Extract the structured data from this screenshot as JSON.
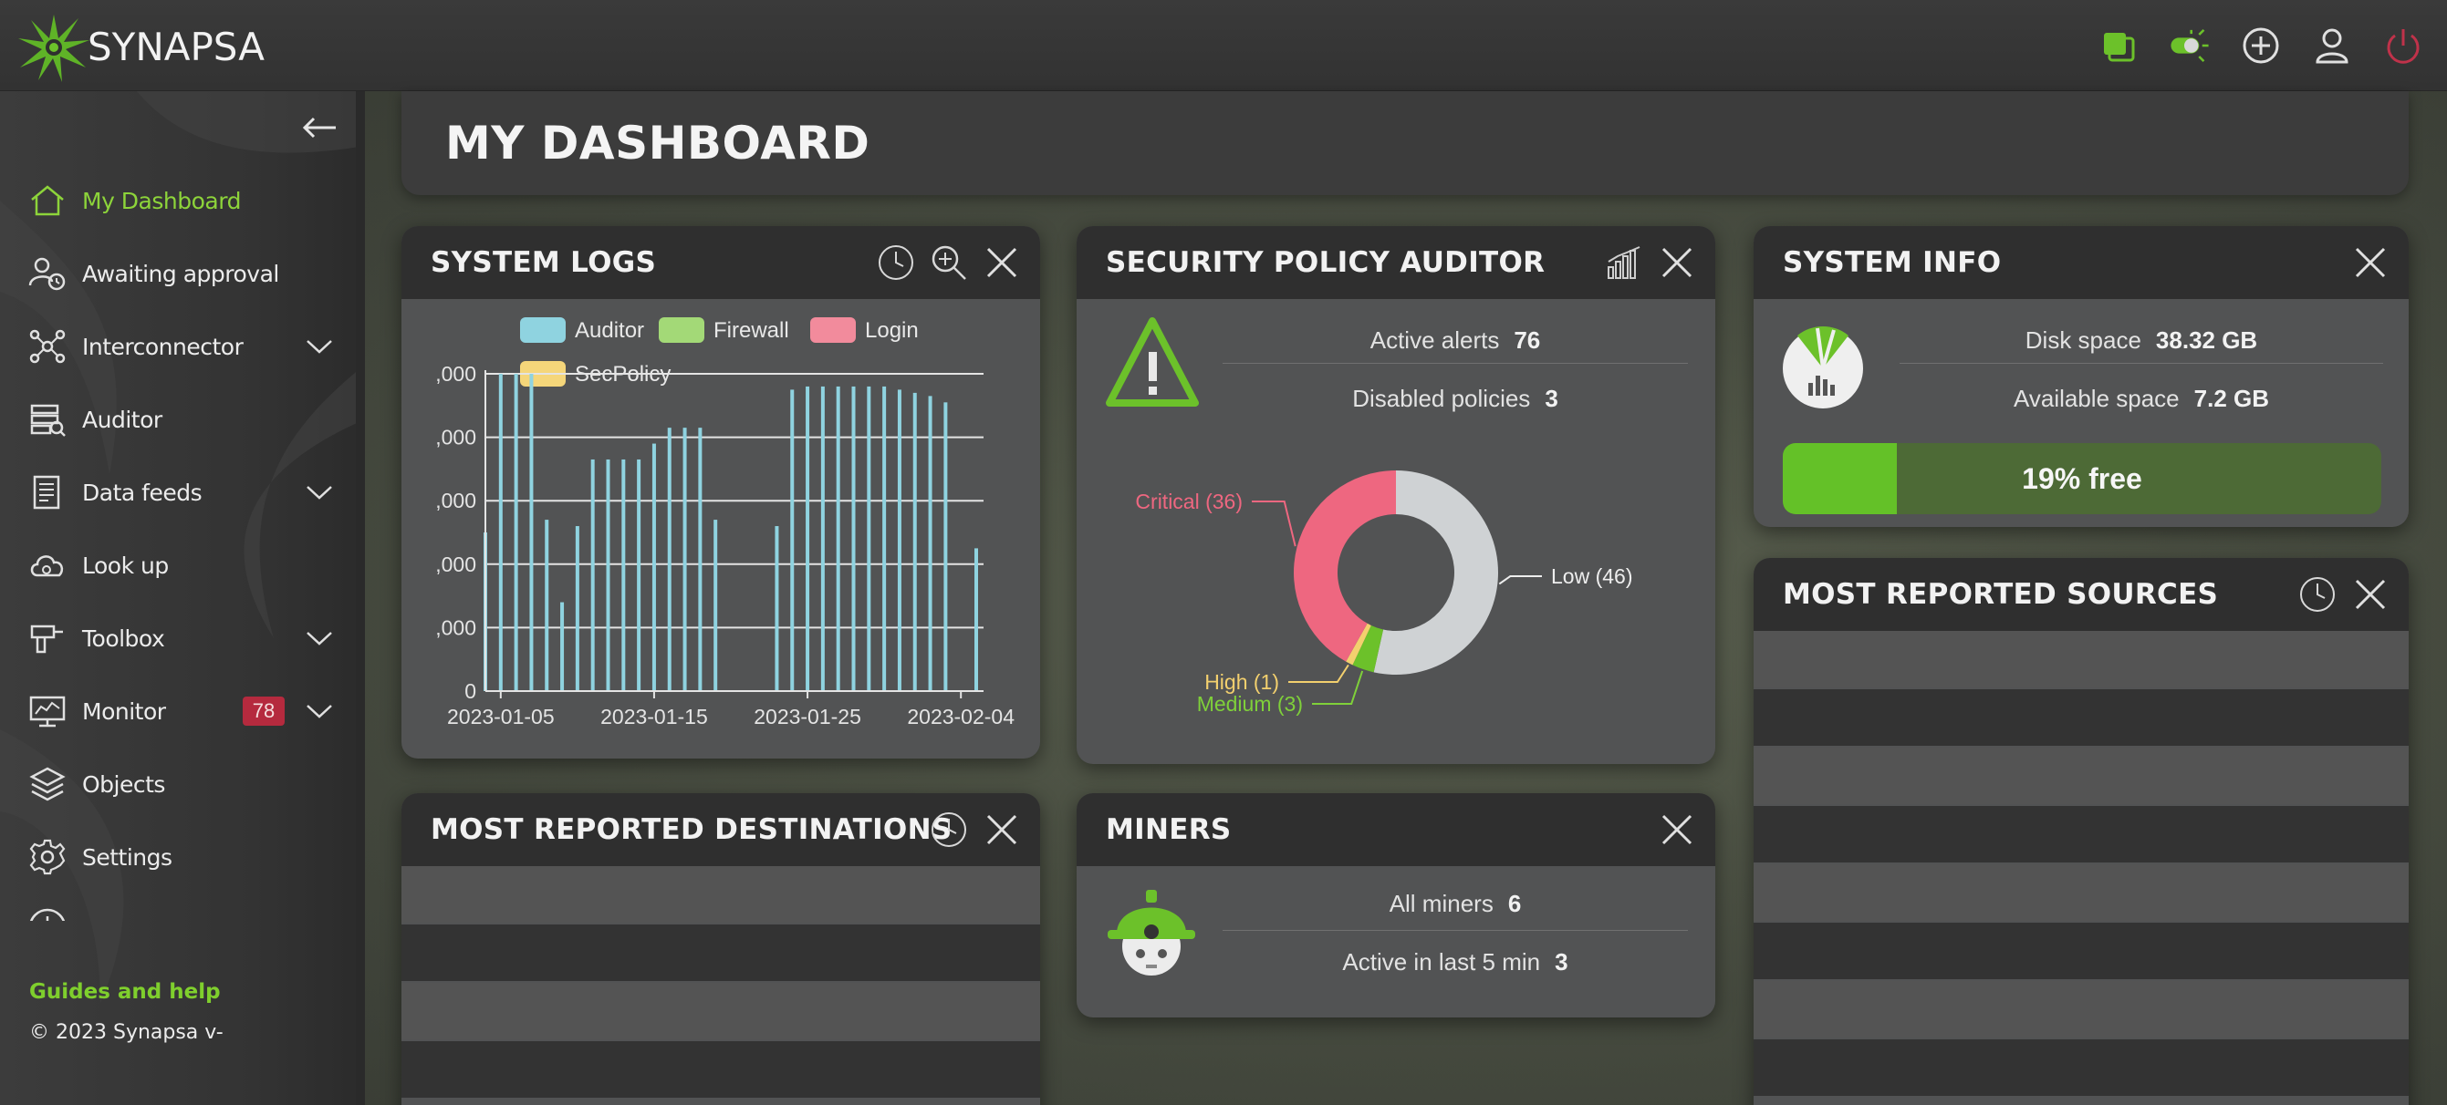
{
  "app": {
    "name": "SYNAPSA",
    "brand_color": "#6cc12a",
    "top_icons": [
      "window-icon",
      "theme-toggle-icon",
      "add-icon",
      "user-icon",
      "power-icon"
    ]
  },
  "sidebar": {
    "items": [
      {
        "label": "My Dashboard",
        "icon": "home-icon",
        "active": true
      },
      {
        "label": "Awaiting approval",
        "icon": "user-clock-icon"
      },
      {
        "label": "Interconnector",
        "icon": "network-icon",
        "expandable": true
      },
      {
        "label": "Auditor",
        "icon": "auditor-icon"
      },
      {
        "label": "Data feeds",
        "icon": "document-icon",
        "expandable": true
      },
      {
        "label": "Look up",
        "icon": "cloud-search-icon"
      },
      {
        "label": "Toolbox",
        "icon": "drill-icon",
        "expandable": true
      },
      {
        "label": "Monitor",
        "icon": "monitor-icon",
        "expandable": true,
        "badge": "78"
      },
      {
        "label": "Objects",
        "icon": "layers-icon"
      },
      {
        "label": "Settings",
        "icon": "gear-icon"
      }
    ],
    "guides_label": "Guides and help",
    "copyright": "© 2023 Synapsa v-"
  },
  "page": {
    "title": "MY DASHBOARD"
  },
  "system_logs": {
    "title": "SYSTEM LOGS",
    "legend": [
      {
        "name": "Auditor",
        "color": "#8fd3e0"
      },
      {
        "name": "Firewall",
        "color": "#a3d977"
      },
      {
        "name": "Login",
        "color": "#f28b9c"
      },
      {
        "name": "SecPolicy",
        "color": "#f5d67a"
      }
    ]
  },
  "chart_data": {
    "type": "bar",
    "series": [
      {
        "name": "Auditor",
        "color": "#8fd3e0",
        "points": [
          [
            "2023-01-04",
            2500
          ],
          [
            "2023-01-05",
            5000
          ],
          [
            "2023-01-06",
            5000
          ],
          [
            "2023-01-07",
            5000
          ],
          [
            "2023-01-08",
            2700
          ],
          [
            "2023-01-09",
            1400
          ],
          [
            "2023-01-10",
            2600
          ],
          [
            "2023-01-11",
            3650
          ],
          [
            "2023-01-12",
            3650
          ],
          [
            "2023-01-13",
            3650
          ],
          [
            "2023-01-14",
            3650
          ],
          [
            "2023-01-15",
            3900
          ],
          [
            "2023-01-16",
            4150
          ],
          [
            "2023-01-17",
            4150
          ],
          [
            "2023-01-18",
            4150
          ],
          [
            "2023-01-19",
            2700
          ],
          [
            "2023-01-23",
            2600
          ],
          [
            "2023-01-24",
            4750
          ],
          [
            "2023-01-25",
            4800
          ],
          [
            "2023-01-26",
            4800
          ],
          [
            "2023-01-27",
            4800
          ],
          [
            "2023-01-28",
            4800
          ],
          [
            "2023-01-29",
            4800
          ],
          [
            "2023-01-30",
            4800
          ],
          [
            "2023-01-31",
            4750
          ],
          [
            "2023-02-01",
            4700
          ],
          [
            "2023-02-02",
            4650
          ],
          [
            "2023-02-03",
            4550
          ],
          [
            "2023-02-05",
            2250
          ]
        ]
      }
    ],
    "x_ticks": [
      "2023-01-05",
      "2023-01-15",
      "2023-01-25",
      "2023-02-04"
    ],
    "y_ticks": [
      ",000",
      ",000",
      ",000",
      ",000",
      ",000",
      "0"
    ],
    "x_range": [
      "2023-01-04",
      "2023-02-05"
    ],
    "ylim": [
      0,
      5000
    ],
    "grid": true,
    "legend_position": "top"
  },
  "security_auditor": {
    "title": "SECURITY POLICY AUDITOR",
    "active_alerts_label": "Active alerts",
    "active_alerts_value": "76",
    "disabled_policies_label": "Disabled policies",
    "disabled_policies_value": "3",
    "donut": [
      {
        "label": "Low (46)",
        "value": 46,
        "color": "#cfd2d4",
        "label_color": "#eeeeee"
      },
      {
        "label": "Medium (3)",
        "value": 3,
        "color": "#6cc12a",
        "label_color": "#7fd03a"
      },
      {
        "label": "High (1)",
        "value": 1,
        "color": "#f3d06e",
        "label_color": "#f3d06e"
      },
      {
        "label": "Critical (36)",
        "value": 36,
        "color": "#ee6780",
        "label_color": "#ee6780"
      }
    ]
  },
  "system_info": {
    "title": "SYSTEM INFO",
    "disk_space_label": "Disk space",
    "disk_space_value": "38.32 GB",
    "available_label": "Available space",
    "available_value": "7.2 GB",
    "free_fraction": 0.19,
    "free_text": "19% free"
  },
  "most_reported_sources": {
    "title": "MOST REPORTED SOURCES"
  },
  "most_reported_destinations": {
    "title": "MOST REPORTED DESTINATIONS"
  },
  "miners": {
    "title": "MINERS",
    "all_label": "All miners",
    "all_value": "6",
    "active_label": "Active in last 5 min",
    "active_value": "3"
  }
}
